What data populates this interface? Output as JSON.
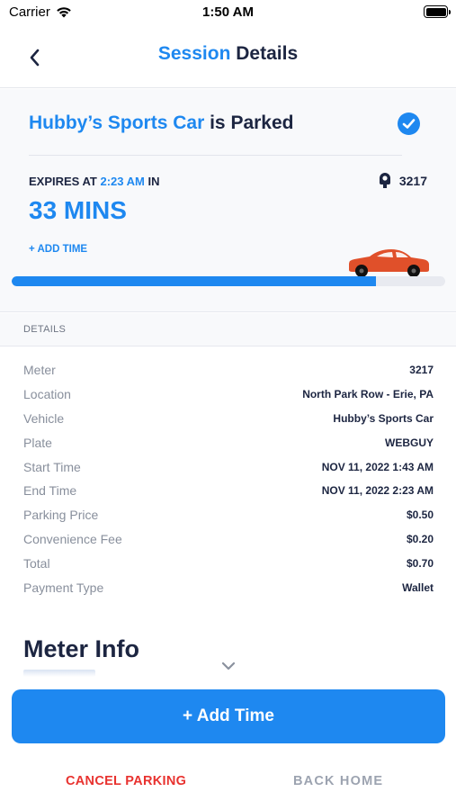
{
  "status_bar": {
    "carrier": "Carrier",
    "time": "1:50 AM"
  },
  "nav": {
    "title_accent": "Session",
    "title_rest": " Details"
  },
  "session": {
    "vehicle_name": "Hubby’s Sports Car",
    "parked_suffix": " is Parked",
    "expires_prefix": "EXPIRES AT ",
    "expires_time": "2:23 AM",
    "expires_suffix": " IN",
    "meter_number": "3217",
    "remaining": "33 MINS",
    "add_time_link": "+ ADD TIME",
    "progress_fraction": 0.841,
    "accent_color": "#1e88f0",
    "car_color": "#e0502a"
  },
  "details": {
    "header": "DETAILS",
    "rows": [
      {
        "label": "Meter",
        "value": "3217"
      },
      {
        "label": "Location",
        "value": "North Park Row - Erie, PA"
      },
      {
        "label": "Vehicle",
        "value": "Hubby’s Sports Car"
      },
      {
        "label": "Plate",
        "value": "WEBGUY"
      },
      {
        "label": "Start Time",
        "value": "NOV 11, 2022 1:43 AM"
      },
      {
        "label": "End Time",
        "value": "NOV 11, 2022 2:23 AM"
      },
      {
        "label": "Parking Price",
        "value": "$0.50"
      },
      {
        "label": "Convenience Fee",
        "value": "$0.20"
      },
      {
        "label": "Total",
        "value": "$0.70"
      },
      {
        "label": "Payment Type",
        "value": "Wallet"
      }
    ]
  },
  "meter_info": {
    "title": "Meter Info"
  },
  "actions": {
    "add_time": "+ Add Time",
    "cancel": "CANCEL PARKING",
    "home": "BACK HOME"
  },
  "icons": {
    "wifi": "wifi-icon",
    "battery": "battery-icon",
    "back": "chevron-left-icon",
    "check": "check-circle-icon",
    "meter": "parking-meter-icon",
    "car": "car-icon",
    "expand": "chevron-down-icon"
  }
}
